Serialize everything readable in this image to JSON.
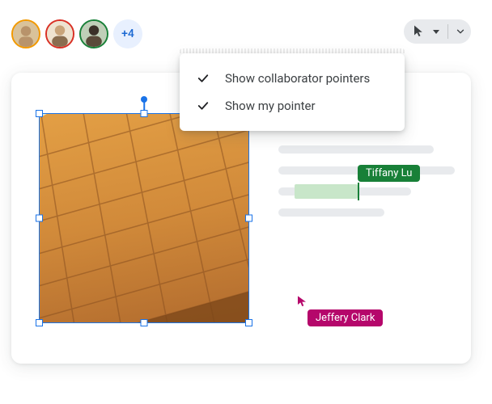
{
  "collaborators": {
    "avatars": [
      {
        "ring_color": "#f29900"
      },
      {
        "ring_color": "#d93025"
      },
      {
        "ring_color": "#188038"
      }
    ],
    "more_count": "+4"
  },
  "toolbar": {
    "pointer_tool": "pointer"
  },
  "dropdown": {
    "items": [
      {
        "label": "Show collaborator pointers",
        "checked": true
      },
      {
        "label": "Show my pointer",
        "checked": true
      }
    ]
  },
  "canvas": {
    "selected_image": "building-photo",
    "collab_cursors": [
      {
        "name": "Tiffany Lu",
        "color": "#188038"
      },
      {
        "name": "Jeffery Clark",
        "color": "#b5076b"
      }
    ]
  }
}
